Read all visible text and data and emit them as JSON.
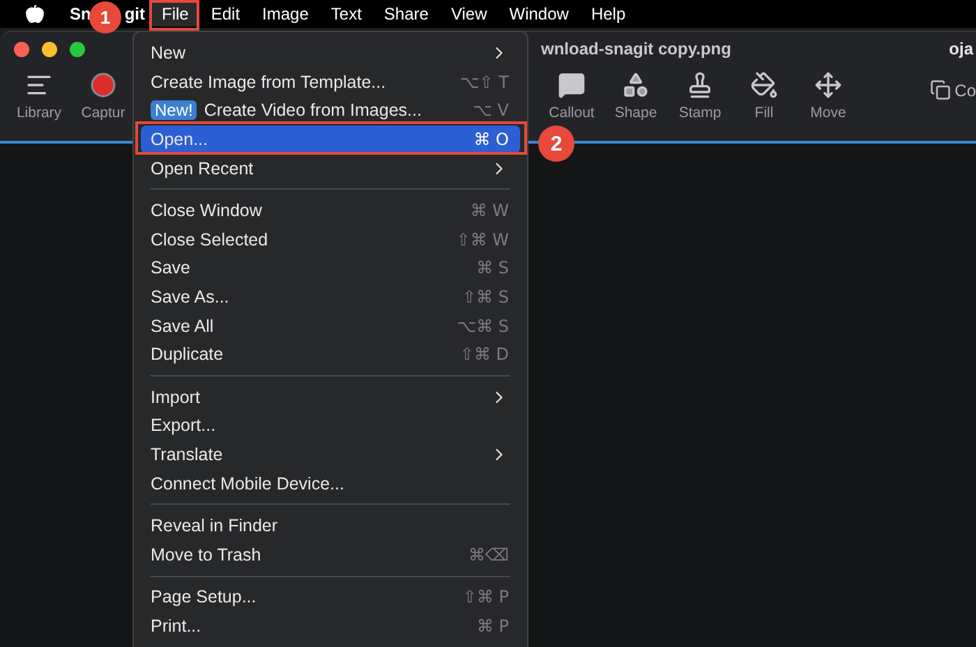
{
  "menu_bar": {
    "items": [
      {
        "label": "Sn",
        "kind": "app",
        "selected": false
      },
      {
        "label": "git",
        "kind": "app",
        "selected": false
      },
      {
        "label": "File",
        "kind": "menu",
        "selected": true
      },
      {
        "label": "Edit",
        "kind": "menu",
        "selected": false
      },
      {
        "label": "Image",
        "kind": "menu",
        "selected": false
      },
      {
        "label": "Text",
        "kind": "menu",
        "selected": false
      },
      {
        "label": "Share",
        "kind": "menu",
        "selected": false
      },
      {
        "label": "View",
        "kind": "menu",
        "selected": false
      },
      {
        "label": "Window",
        "kind": "menu",
        "selected": false
      },
      {
        "label": "Help",
        "kind": "menu",
        "selected": false
      }
    ]
  },
  "window": {
    "title": "wnload-snagit copy.png",
    "user": "oja"
  },
  "toolbar": {
    "left": [
      {
        "label": "Library",
        "kind": "library"
      },
      {
        "label": "Captur",
        "kind": "capture"
      }
    ],
    "right": [
      {
        "label": "Callout",
        "kind": "callout"
      },
      {
        "label": "Shape",
        "kind": "shape"
      },
      {
        "label": "Stamp",
        "kind": "stamp"
      },
      {
        "label": "Fill",
        "kind": "fill"
      },
      {
        "label": "Move",
        "kind": "move"
      }
    ],
    "copy": {
      "label": "Co"
    }
  },
  "file_menu": {
    "sections": [
      [
        {
          "label": "New",
          "submenu": true,
          "selected": false
        },
        {
          "label": "Create Image from Template...",
          "shortcut": "⌥⇧ T",
          "submenu": false,
          "selected": false
        },
        {
          "label": "Create Video from Images...",
          "badge": "New!",
          "shortcut": "⌥ V",
          "submenu": false,
          "selected": false
        },
        {
          "label": "Open...",
          "shortcut": "⌘ O",
          "submenu": false,
          "selected": true
        },
        {
          "label": "Open Recent",
          "submenu": true,
          "selected": false
        }
      ],
      [
        {
          "label": "Close Window",
          "shortcut": "⌘ W",
          "submenu": false,
          "selected": false
        },
        {
          "label": "Close Selected",
          "shortcut": "⇧⌘ W",
          "submenu": false,
          "selected": false
        },
        {
          "label": "Save",
          "shortcut": "⌘ S",
          "submenu": false,
          "selected": false
        },
        {
          "label": "Save As...",
          "shortcut": "⇧⌘ S",
          "submenu": false,
          "selected": false
        },
        {
          "label": "Save All",
          "shortcut": "⌥⌘ S",
          "submenu": false,
          "selected": false
        },
        {
          "label": "Duplicate",
          "shortcut": "⇧⌘ D",
          "submenu": false,
          "selected": false
        }
      ],
      [
        {
          "label": "Import",
          "submenu": true,
          "selected": false
        },
        {
          "label": "Export...",
          "submenu": false,
          "selected": false
        },
        {
          "label": "Translate",
          "submenu": true,
          "selected": false
        },
        {
          "label": "Connect Mobile Device...",
          "submenu": false,
          "selected": false
        }
      ],
      [
        {
          "label": "Reveal in Finder",
          "submenu": false,
          "selected": false
        },
        {
          "label": "Move to Trash",
          "shortcut": "⌘⌫",
          "submenu": false,
          "selected": false
        }
      ],
      [
        {
          "label": "Page Setup...",
          "shortcut": "⇧⌘ P",
          "submenu": false,
          "selected": false
        },
        {
          "label": "Print...",
          "shortcut": "⌘ P",
          "submenu": false,
          "selected": false
        }
      ]
    ]
  },
  "annotations": [
    {
      "number": "1"
    },
    {
      "number": "2"
    }
  ]
}
